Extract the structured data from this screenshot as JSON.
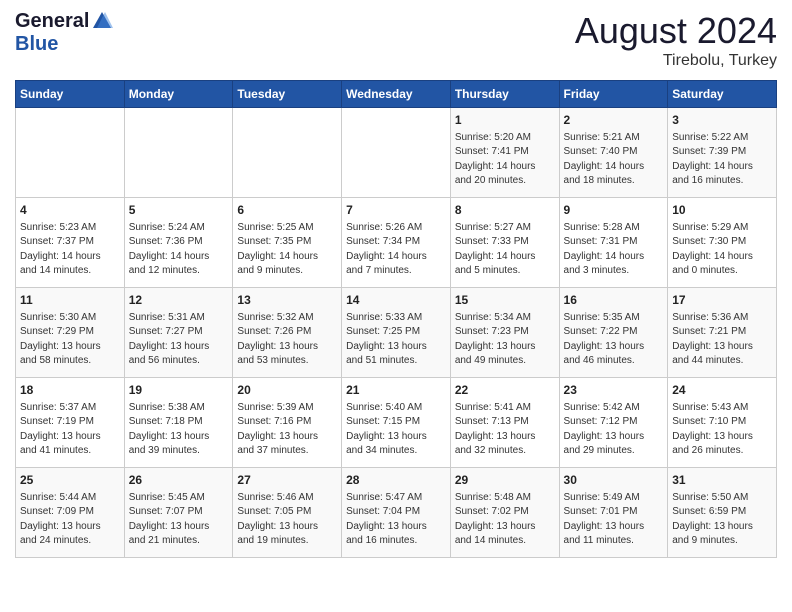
{
  "logo": {
    "general": "General",
    "blue": "Blue"
  },
  "title": "August 2024",
  "subtitle": "Tirebolu, Turkey",
  "days_of_week": [
    "Sunday",
    "Monday",
    "Tuesday",
    "Wednesday",
    "Thursday",
    "Friday",
    "Saturday"
  ],
  "weeks": [
    [
      {
        "day": "",
        "info": ""
      },
      {
        "day": "",
        "info": ""
      },
      {
        "day": "",
        "info": ""
      },
      {
        "day": "",
        "info": ""
      },
      {
        "day": "1",
        "info": "Sunrise: 5:20 AM\nSunset: 7:41 PM\nDaylight: 14 hours\nand 20 minutes."
      },
      {
        "day": "2",
        "info": "Sunrise: 5:21 AM\nSunset: 7:40 PM\nDaylight: 14 hours\nand 18 minutes."
      },
      {
        "day": "3",
        "info": "Sunrise: 5:22 AM\nSunset: 7:39 PM\nDaylight: 14 hours\nand 16 minutes."
      }
    ],
    [
      {
        "day": "4",
        "info": "Sunrise: 5:23 AM\nSunset: 7:37 PM\nDaylight: 14 hours\nand 14 minutes."
      },
      {
        "day": "5",
        "info": "Sunrise: 5:24 AM\nSunset: 7:36 PM\nDaylight: 14 hours\nand 12 minutes."
      },
      {
        "day": "6",
        "info": "Sunrise: 5:25 AM\nSunset: 7:35 PM\nDaylight: 14 hours\nand 9 minutes."
      },
      {
        "day": "7",
        "info": "Sunrise: 5:26 AM\nSunset: 7:34 PM\nDaylight: 14 hours\nand 7 minutes."
      },
      {
        "day": "8",
        "info": "Sunrise: 5:27 AM\nSunset: 7:33 PM\nDaylight: 14 hours\nand 5 minutes."
      },
      {
        "day": "9",
        "info": "Sunrise: 5:28 AM\nSunset: 7:31 PM\nDaylight: 14 hours\nand 3 minutes."
      },
      {
        "day": "10",
        "info": "Sunrise: 5:29 AM\nSunset: 7:30 PM\nDaylight: 14 hours\nand 0 minutes."
      }
    ],
    [
      {
        "day": "11",
        "info": "Sunrise: 5:30 AM\nSunset: 7:29 PM\nDaylight: 13 hours\nand 58 minutes."
      },
      {
        "day": "12",
        "info": "Sunrise: 5:31 AM\nSunset: 7:27 PM\nDaylight: 13 hours\nand 56 minutes."
      },
      {
        "day": "13",
        "info": "Sunrise: 5:32 AM\nSunset: 7:26 PM\nDaylight: 13 hours\nand 53 minutes."
      },
      {
        "day": "14",
        "info": "Sunrise: 5:33 AM\nSunset: 7:25 PM\nDaylight: 13 hours\nand 51 minutes."
      },
      {
        "day": "15",
        "info": "Sunrise: 5:34 AM\nSunset: 7:23 PM\nDaylight: 13 hours\nand 49 minutes."
      },
      {
        "day": "16",
        "info": "Sunrise: 5:35 AM\nSunset: 7:22 PM\nDaylight: 13 hours\nand 46 minutes."
      },
      {
        "day": "17",
        "info": "Sunrise: 5:36 AM\nSunset: 7:21 PM\nDaylight: 13 hours\nand 44 minutes."
      }
    ],
    [
      {
        "day": "18",
        "info": "Sunrise: 5:37 AM\nSunset: 7:19 PM\nDaylight: 13 hours\nand 41 minutes."
      },
      {
        "day": "19",
        "info": "Sunrise: 5:38 AM\nSunset: 7:18 PM\nDaylight: 13 hours\nand 39 minutes."
      },
      {
        "day": "20",
        "info": "Sunrise: 5:39 AM\nSunset: 7:16 PM\nDaylight: 13 hours\nand 37 minutes."
      },
      {
        "day": "21",
        "info": "Sunrise: 5:40 AM\nSunset: 7:15 PM\nDaylight: 13 hours\nand 34 minutes."
      },
      {
        "day": "22",
        "info": "Sunrise: 5:41 AM\nSunset: 7:13 PM\nDaylight: 13 hours\nand 32 minutes."
      },
      {
        "day": "23",
        "info": "Sunrise: 5:42 AM\nSunset: 7:12 PM\nDaylight: 13 hours\nand 29 minutes."
      },
      {
        "day": "24",
        "info": "Sunrise: 5:43 AM\nSunset: 7:10 PM\nDaylight: 13 hours\nand 26 minutes."
      }
    ],
    [
      {
        "day": "25",
        "info": "Sunrise: 5:44 AM\nSunset: 7:09 PM\nDaylight: 13 hours\nand 24 minutes."
      },
      {
        "day": "26",
        "info": "Sunrise: 5:45 AM\nSunset: 7:07 PM\nDaylight: 13 hours\nand 21 minutes."
      },
      {
        "day": "27",
        "info": "Sunrise: 5:46 AM\nSunset: 7:05 PM\nDaylight: 13 hours\nand 19 minutes."
      },
      {
        "day": "28",
        "info": "Sunrise: 5:47 AM\nSunset: 7:04 PM\nDaylight: 13 hours\nand 16 minutes."
      },
      {
        "day": "29",
        "info": "Sunrise: 5:48 AM\nSunset: 7:02 PM\nDaylight: 13 hours\nand 14 minutes."
      },
      {
        "day": "30",
        "info": "Sunrise: 5:49 AM\nSunset: 7:01 PM\nDaylight: 13 hours\nand 11 minutes."
      },
      {
        "day": "31",
        "info": "Sunrise: 5:50 AM\nSunset: 6:59 PM\nDaylight: 13 hours\nand 9 minutes."
      }
    ]
  ]
}
